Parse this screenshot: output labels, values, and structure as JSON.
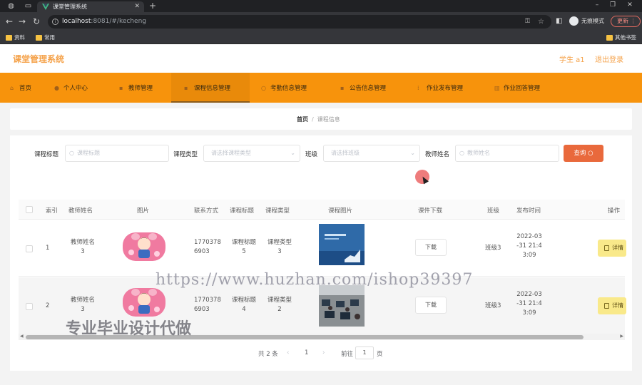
{
  "browser": {
    "tab_title": "课堂管理系统",
    "url_host": "localhost",
    "url_rest": ":8081/#/kecheng",
    "incognito_label": "无痕模式",
    "update_label": "更新",
    "bookmarks": [
      "资料",
      "常用"
    ],
    "other_bookmarks": "其他书签"
  },
  "app": {
    "title": "课堂管理系统",
    "user": "学生 a1",
    "logout": "退出登录"
  },
  "nav": [
    {
      "label": "首页",
      "icon": "home-icon"
    },
    {
      "label": "个人中心",
      "icon": "user-icon"
    },
    {
      "label": "教师管理",
      "icon": "teacher-icon"
    },
    {
      "label": "课程信息管理",
      "icon": "course-icon",
      "active": true
    },
    {
      "label": "考勤信息管理",
      "icon": "attendance-icon"
    },
    {
      "label": "公告信息管理",
      "icon": "notice-icon"
    },
    {
      "label": "作业发布管理",
      "icon": "assignment-icon"
    },
    {
      "label": "作业回答管理",
      "icon": "answer-icon"
    }
  ],
  "breadcrumb": {
    "home": "首页",
    "current": "课程信息"
  },
  "search": {
    "title_label": "课程标题",
    "title_placeholder": "课程标题",
    "type_label": "课程类型",
    "type_placeholder": "请选择课程类型",
    "class_label": "班级",
    "class_placeholder": "请选择班级",
    "teacher_label": "教师姓名",
    "teacher_placeholder": "教师姓名",
    "query_label": "查询"
  },
  "table": {
    "headers": [
      "索引",
      "教师姓名",
      "图片",
      "联系方式",
      "课程标题",
      "课程类型",
      "课程图片",
      "课件下载",
      "班级",
      "发布时间",
      "操作"
    ],
    "download_label": "下载",
    "detail_label": "详情",
    "rows": [
      {
        "index": "1",
        "teacher": [
          "教师姓名",
          "3"
        ],
        "phone": [
          "1770378",
          "6903"
        ],
        "title": [
          "课程标题",
          "5"
        ],
        "type": [
          "课程类型",
          "3"
        ],
        "class": "班级3",
        "time": [
          "2022-03",
          "-31 21:4",
          "3:09"
        ]
      },
      {
        "index": "2",
        "teacher": [
          "教师姓名",
          "3"
        ],
        "phone": [
          "1770378",
          "6903"
        ],
        "title": [
          "课程标题",
          "4"
        ],
        "type": [
          "课程类型",
          "2"
        ],
        "class": "班级3",
        "time": [
          "2022-03",
          "-31 21:4",
          "3:09"
        ]
      }
    ]
  },
  "pagination": {
    "total": "共 2 条",
    "page": "1",
    "goto_label": "前往",
    "goto_value": "1",
    "page_suffix": "页"
  },
  "overlay": {
    "watermark_url": "https://www.huzhan.com/ishop39397",
    "watermark_text": "专业毕业设计代做"
  }
}
